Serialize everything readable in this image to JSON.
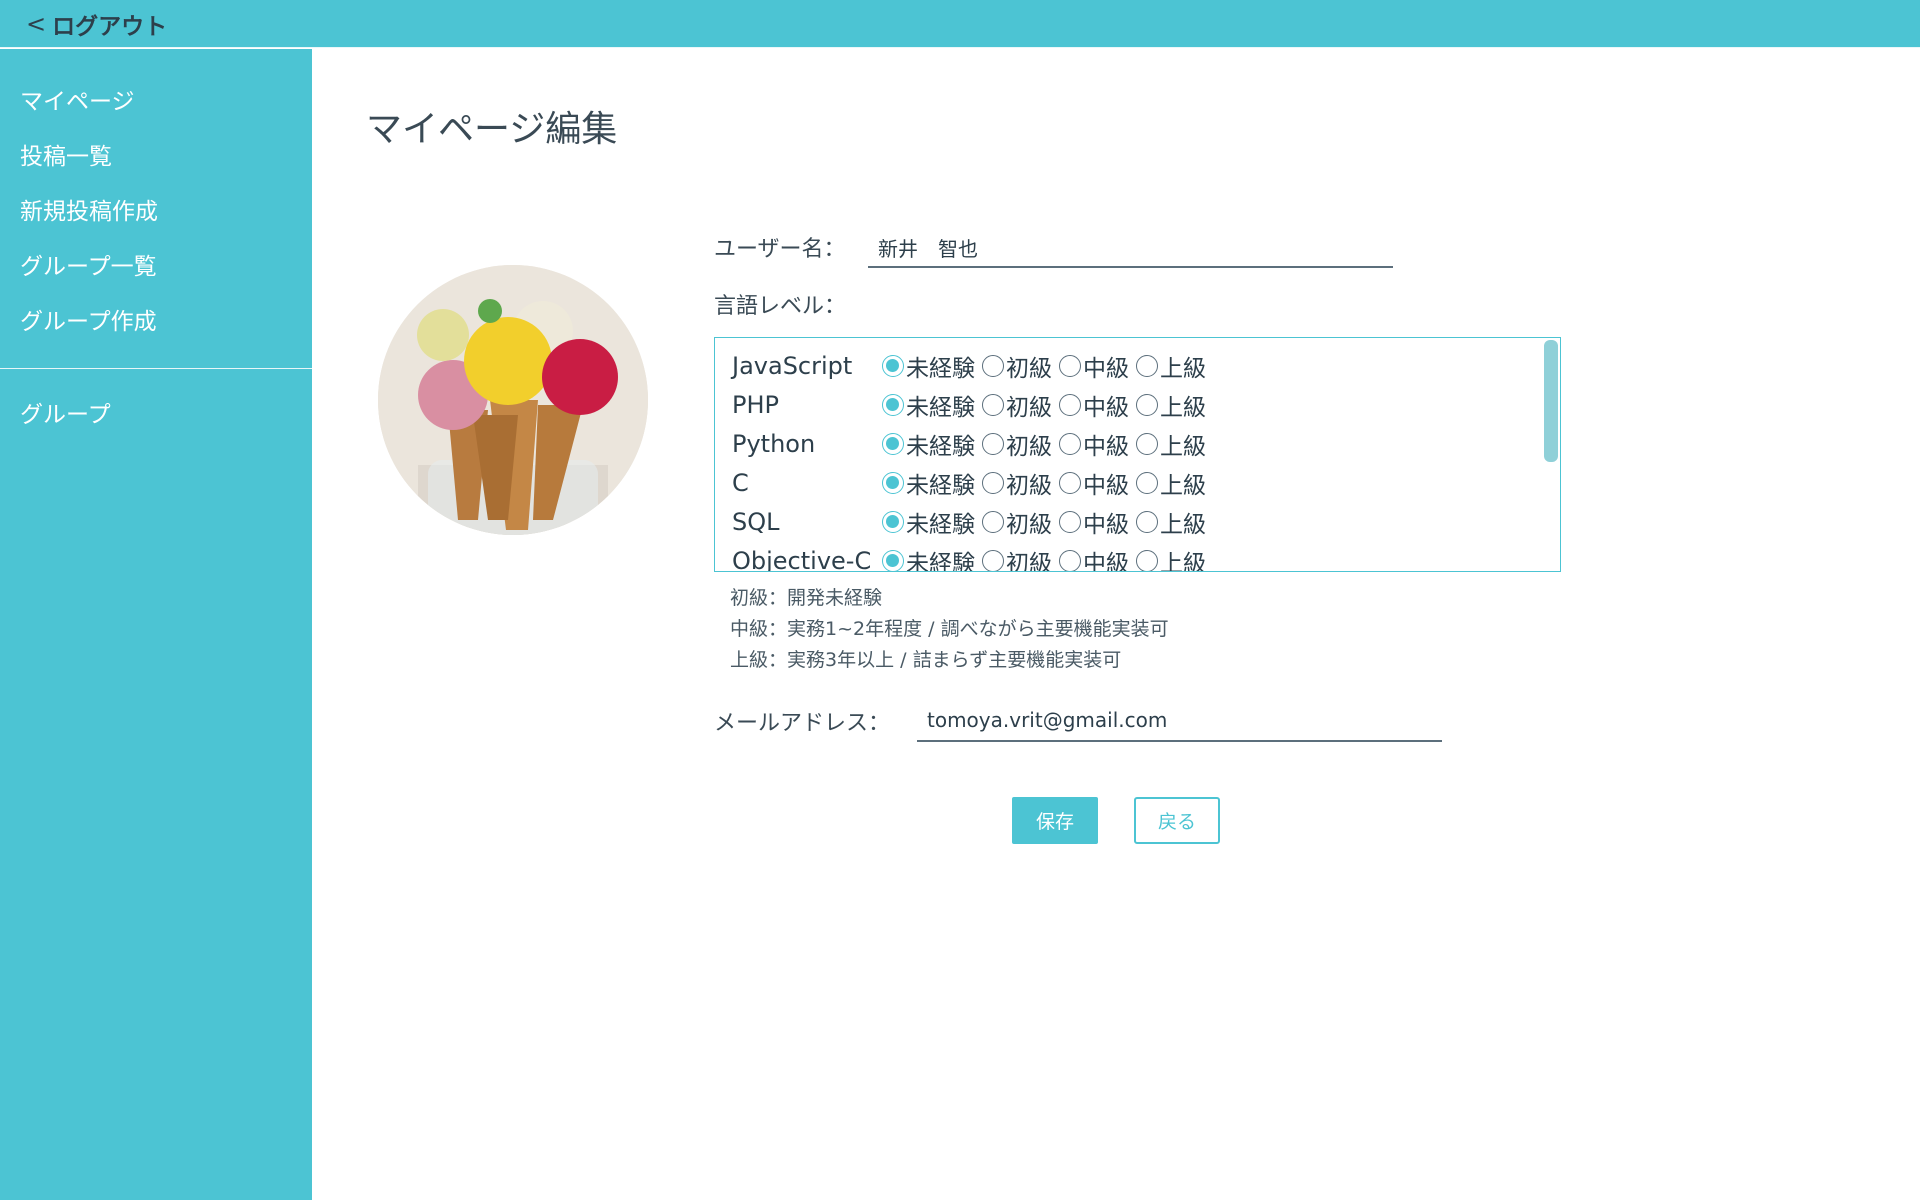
{
  "topbar": {
    "logout_label": "ログアウト",
    "chevron": "<"
  },
  "sidebar": {
    "items": [
      {
        "label": "マイページ"
      },
      {
        "label": "投稿一覧"
      },
      {
        "label": "新規投稿作成"
      },
      {
        "label": "グループ一覧"
      },
      {
        "label": "グループ作成"
      }
    ],
    "groups_label": "グループ"
  },
  "main": {
    "title": "マイページ編集",
    "avatar_icon": "ice-cream-photo",
    "username_label": "ユーザー名：",
    "username_value": "新井　智也",
    "lang_label": "言語レベル：",
    "levels": [
      "未経験",
      "初級",
      "中級",
      "上級"
    ],
    "languages": [
      {
        "name": "JavaScript",
        "selected": "未経験"
      },
      {
        "name": "PHP",
        "selected": "未経験"
      },
      {
        "name": "Python",
        "selected": "未経験"
      },
      {
        "name": "C",
        "selected": "未経験"
      },
      {
        "name": "SQL",
        "selected": "未経験"
      },
      {
        "name": "Objective-C",
        "selected": "未経験"
      }
    ],
    "notes": [
      "初級：開発未経験",
      "中級：実務1~2年程度 / 調べながら主要機能実装可",
      "上級：実務3年以上 / 詰まらず主要機能実装可"
    ],
    "email_label": "メールアドレス：",
    "email_value": "tomoya.vrit@gmail.com",
    "save_label": "保存",
    "back_label": "戻る"
  },
  "colors": {
    "accent": "#4cc4d3",
    "text": "#3a4a55"
  }
}
